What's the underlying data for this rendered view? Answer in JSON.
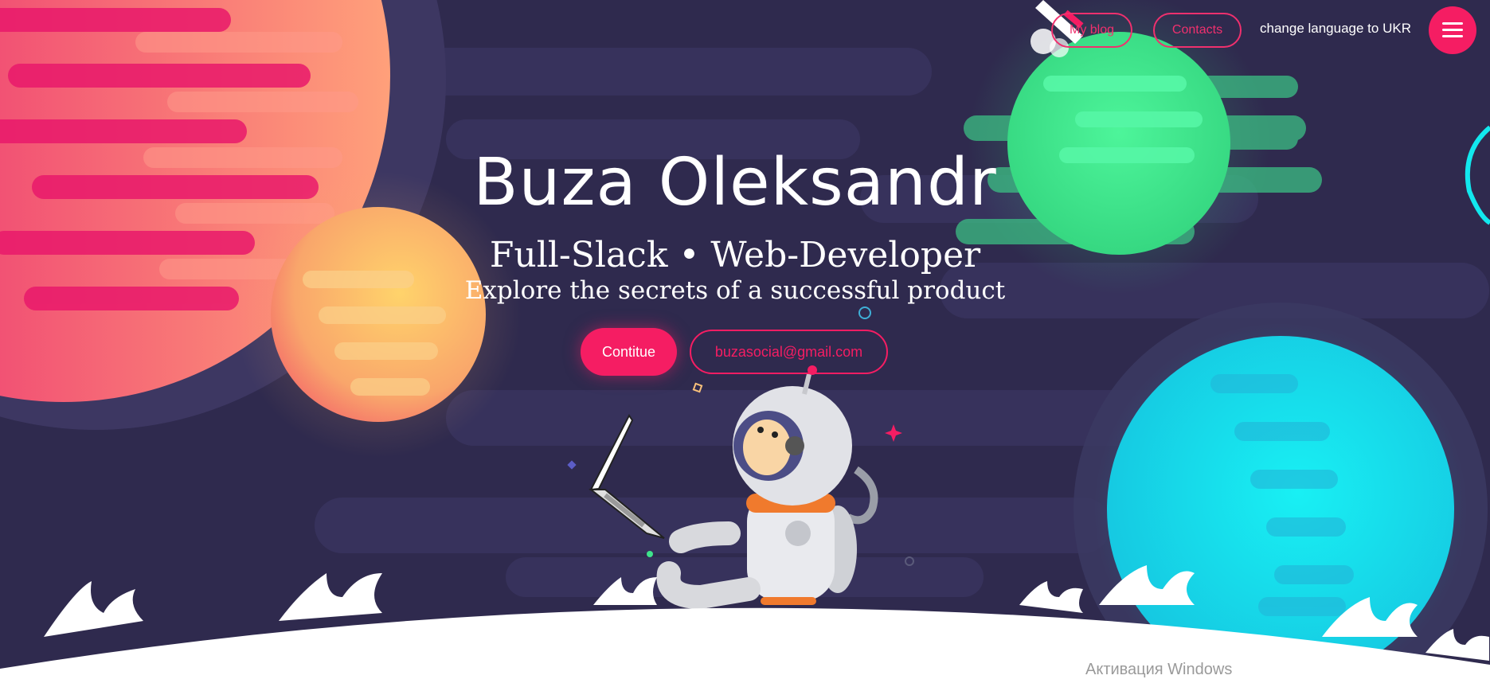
{
  "header": {
    "nav_blog": "My blog",
    "nav_contacts": "Contacts",
    "language_toggle": "change language to UKR",
    "menu_icon": "hamburger-menu-icon"
  },
  "hero": {
    "title": "Buza Oleksandr",
    "role": "Full-Slack • Web-Developer",
    "tagline": "Explore the secrets of a successful product",
    "continue_label": "Contitue",
    "email_label": "buzasocial@gmail.com"
  },
  "watermark": {
    "text": "Активация Windows"
  },
  "colors": {
    "background": "#2f2a4e",
    "accent": "#f51d63",
    "planet_pink": "#ef2f78",
    "planet_green": "#3ee48b",
    "planet_cyan": "#12e8ee",
    "planet_yellow": "#f7c56b"
  }
}
